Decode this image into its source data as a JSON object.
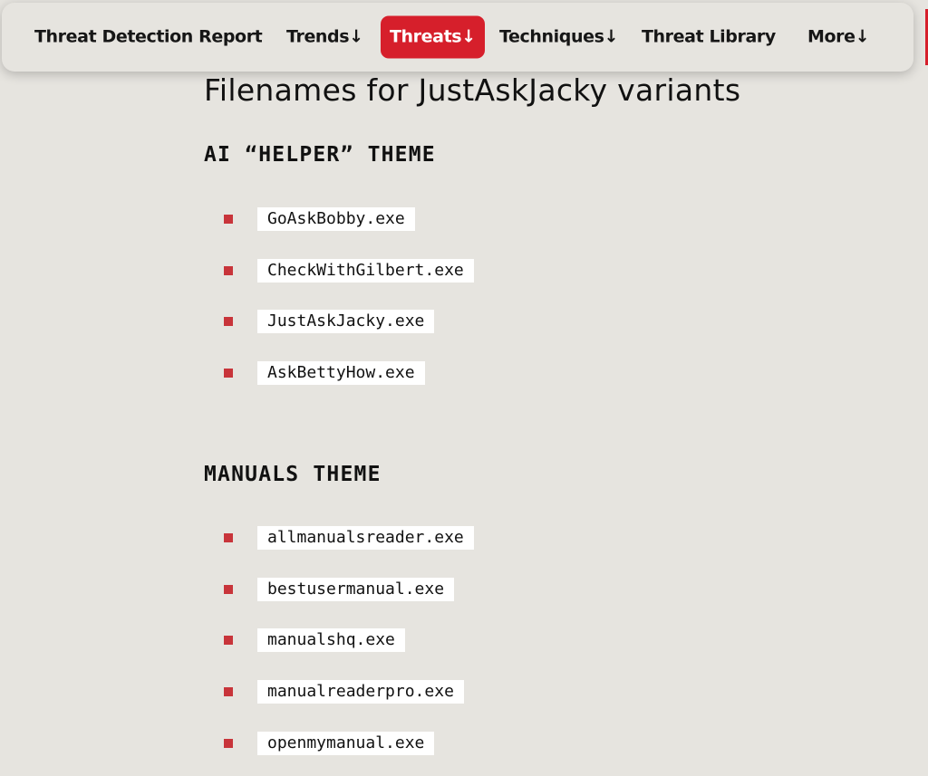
{
  "nav": {
    "brand": "Threat Detection Report",
    "items": [
      {
        "label": "Trends",
        "arrow": "↓"
      },
      {
        "label": "Threats",
        "arrow": "↓"
      },
      {
        "label": "Techniques",
        "arrow": "↓"
      },
      {
        "label": "Threat Library",
        "arrow": ""
      },
      {
        "label": "More",
        "arrow": "↓"
      }
    ],
    "active_color": "#d61f2b"
  },
  "content": {
    "title": "Filenames for JustAskJacky variants",
    "sections": [
      {
        "heading": "AI “HELPER” THEME",
        "files": [
          "GoAskBobby.exe",
          "CheckWithGilbert.exe",
          "JustAskJacky.exe",
          "AskBettyHow.exe"
        ]
      },
      {
        "heading": "MANUALS THEME",
        "files": [
          "allmanualsreader.exe",
          "bestusermanual.exe",
          "manualshq.exe",
          "manualreaderpro.exe",
          "openmymanual.exe"
        ]
      }
    ],
    "bullet_color": "#c8343a",
    "background_color": "#e6e4df"
  }
}
